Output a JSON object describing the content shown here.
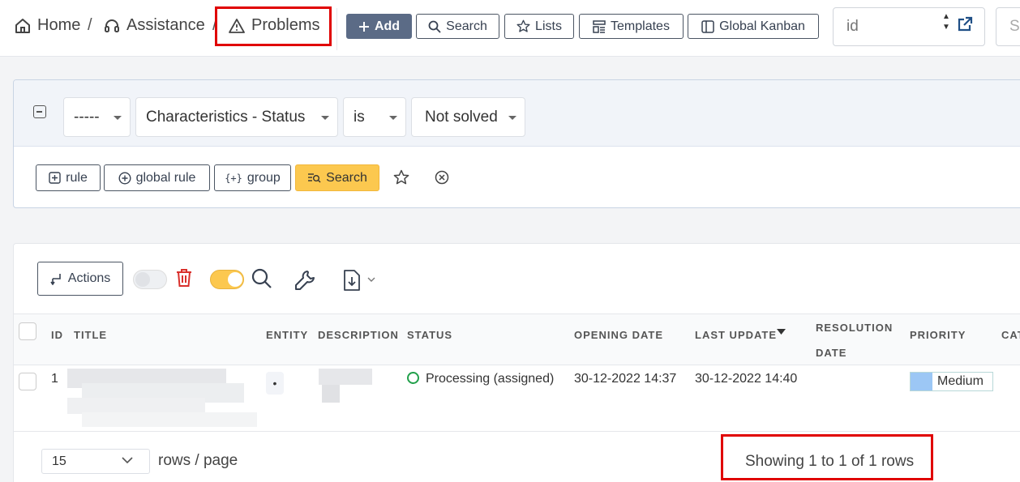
{
  "breadcrumb": {
    "home": "Home",
    "separator1": "/",
    "assistance": "Assistance",
    "separator2": "/",
    "problems": "Problems"
  },
  "toolbar": {
    "add": "Add",
    "search": "Search",
    "lists": "Lists",
    "templates": "Templates",
    "kanban": "Global Kanban",
    "id_placeholder": "id",
    "right_placeholder": "S"
  },
  "filter": {
    "link_op": "-----",
    "field": "Characteristics - Status",
    "operator": "is",
    "value": "Not solved",
    "rule": "rule",
    "global_rule": "global rule",
    "group": "group",
    "search": "Search"
  },
  "list": {
    "actions": "Actions",
    "headers": {
      "id": "ID",
      "title": "TITLE",
      "entity": "ENTITY",
      "description": "DESCRIPTION",
      "status": "STATUS",
      "opening_date": "OPENING DATE",
      "last_update": "LAST UPDATE",
      "resolution_line1": "RESOLUTION",
      "resolution_line2": "DATE",
      "priority": "PRIORITY",
      "category": "CAT"
    },
    "rows": [
      {
        "id": "1",
        "entity": "•",
        "status": "Processing (assigned)",
        "opening_date": "30-12-2022 14:37",
        "last_update": "30-12-2022 14:40",
        "priority": "Medium"
      }
    ]
  },
  "pagination": {
    "rows_per_page": "15",
    "rows_label": "rows / page",
    "showing": "Showing 1 to 1 of 1 rows"
  },
  "colors": {
    "primary_button": "#5b6b86",
    "search_button": "#fcc84f",
    "toggle_on": "#fcc84f",
    "delete_icon": "#d9302c",
    "status_processing": "#22a04b",
    "priority_medium": "#9cc7f5",
    "highlight": "#e00000"
  }
}
